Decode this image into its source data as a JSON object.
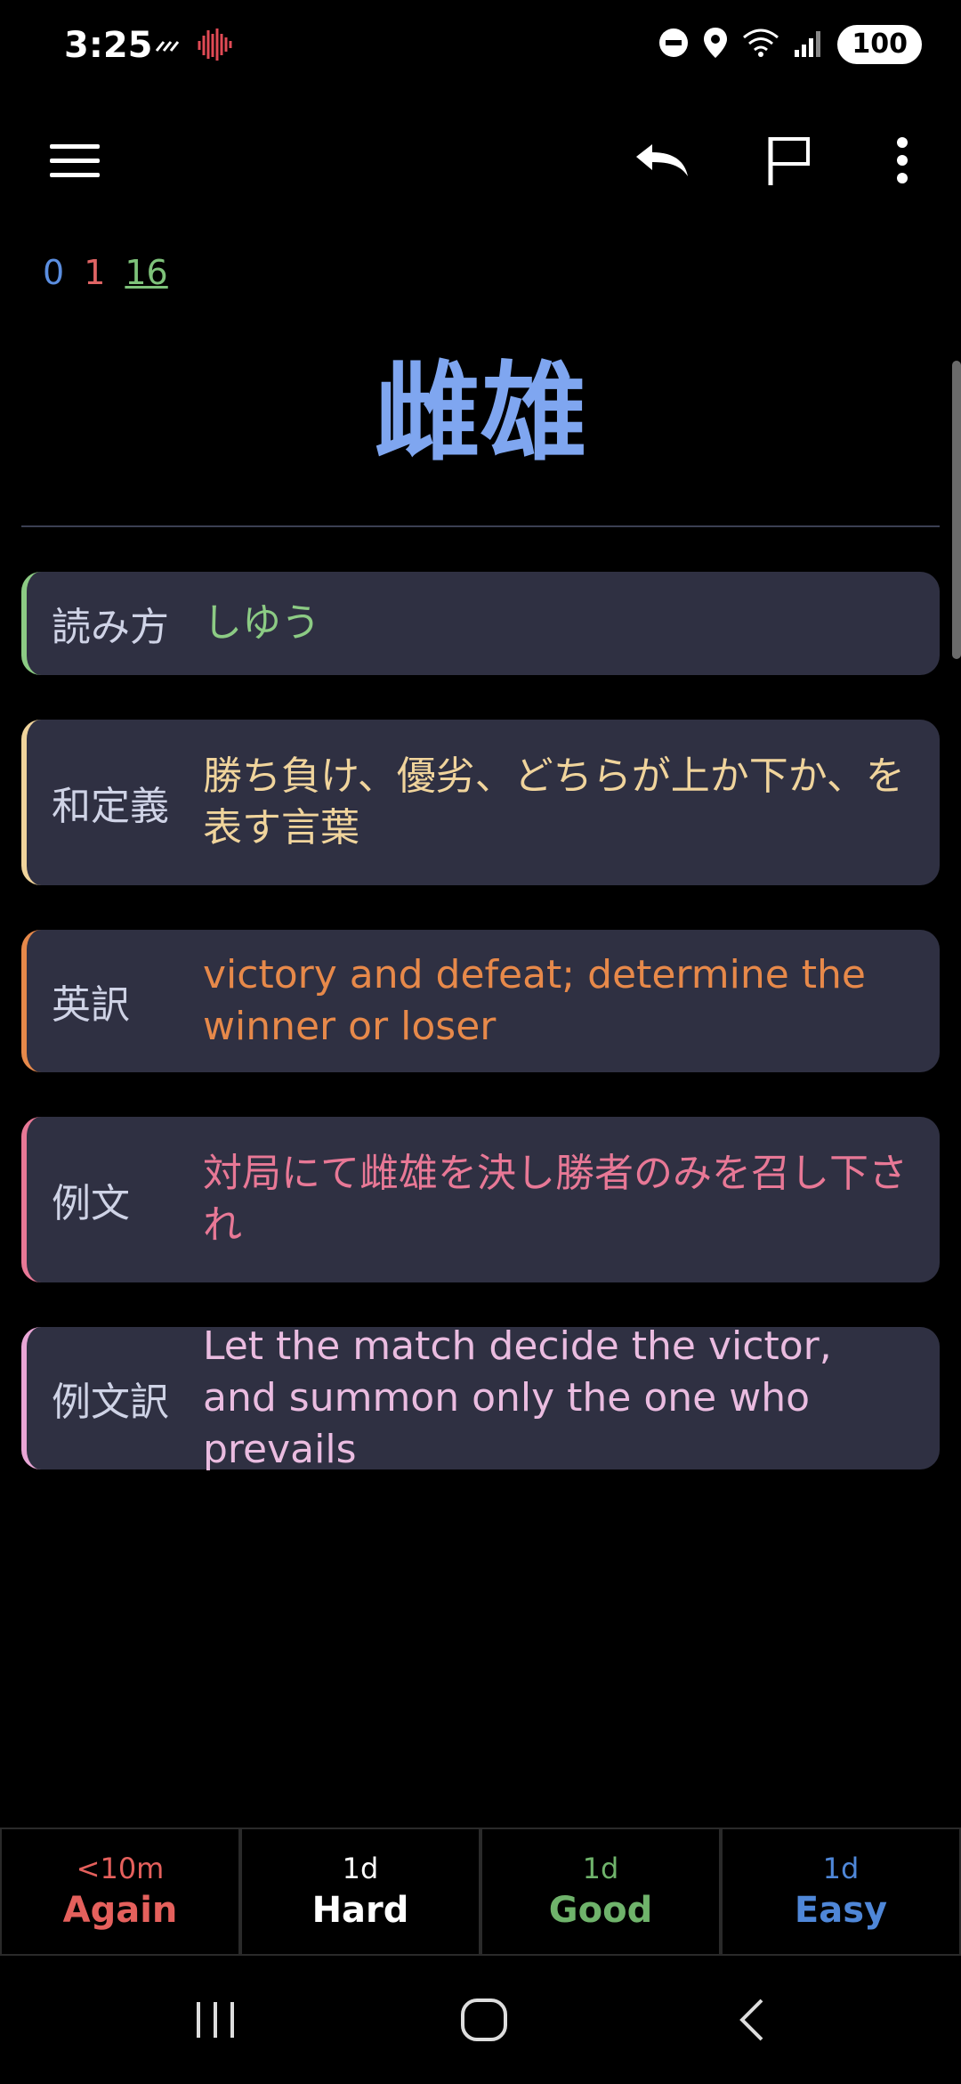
{
  "status_bar": {
    "time": "3:25",
    "battery": "100",
    "icons": [
      "signal-activity-icon",
      "heartbeat-icon",
      "do-not-disturb-icon",
      "location-icon",
      "wifi-icon",
      "cell-signal-icon"
    ]
  },
  "toolbar": {
    "icons": [
      "menu-icon",
      "undo-icon",
      "flag-icon",
      "more-options-icon"
    ]
  },
  "counts": {
    "new": "0",
    "learning": "1",
    "review": "16"
  },
  "card": {
    "word": "雌雄",
    "fields": [
      {
        "label": "読み方",
        "value": "しゆう",
        "color": "#8ccb84"
      },
      {
        "label": "和定義",
        "value": "勝ち負け、優劣、どちらが上か下か、を表す言葉",
        "color": "#f0d49c"
      },
      {
        "label": "英訳",
        "value": "victory and defeat; determine the winner or loser",
        "color": "#e7894a"
      },
      {
        "label": "例文",
        "value": "対局にて雌雄を決し勝者のみを召し下され",
        "color": "#e87896"
      },
      {
        "label": "例文訳",
        "value": "Let the match decide the victor, and summon only the one who prevails",
        "color": "#e9a6d6"
      }
    ]
  },
  "answers": [
    {
      "interval": "<10m",
      "label": "Again",
      "color": "#e5605c"
    },
    {
      "interval": "1d",
      "label": "Hard",
      "color": "#ffffff"
    },
    {
      "interval": "1d",
      "label": "Good",
      "color": "#6fb36b"
    },
    {
      "interval": "1d",
      "label": "Easy",
      "color": "#4f87d8"
    }
  ],
  "nav_bar": {
    "icons": [
      "recent-apps-icon",
      "home-icon",
      "back-icon"
    ]
  }
}
